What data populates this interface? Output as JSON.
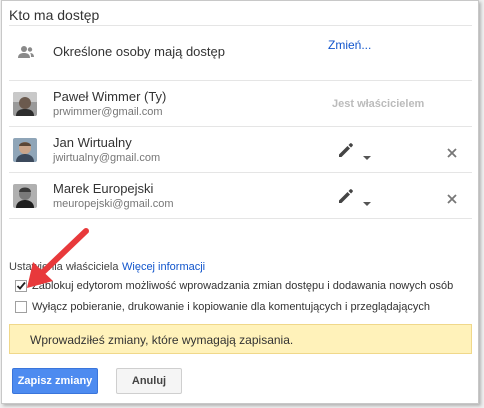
{
  "dialog": {
    "title": "Kto ma dostęp"
  },
  "general_access": {
    "text": "Określone osoby mają dostęp",
    "change_link": "Zmień...",
    "icon": "people-icon"
  },
  "people": [
    {
      "name": "Paweł Wimmer (Ty)",
      "email": "prwimmer@gmail.com",
      "role": "Jest właścicielem"
    },
    {
      "name": "Jan Wirtualny",
      "email": "jwirtualny@gmail.com",
      "role_icon": "pencil-icon"
    },
    {
      "name": "Marek Europejski",
      "email": "meuropejski@gmail.com",
      "role_icon": "pencil-icon"
    }
  ],
  "owner_settings": {
    "label": "Ustawienia właściciela",
    "more_info_link": "Więcej informacji",
    "options": [
      {
        "label": "Zablokuj edytorom możliwość wprowadzania zmian dostępu i dodawania nowych osób",
        "checked": true
      },
      {
        "label": "Wyłącz pobieranie, drukowanie i kopiowanie dla komentujących i przeglądających",
        "checked": false
      }
    ]
  },
  "notice": {
    "text": "Wprowadziłeś zmiany, które wymagają zapisania."
  },
  "buttons": {
    "save": "Zapisz zmiany",
    "cancel": "Anuluj"
  },
  "colors": {
    "accent": "#4d8bf0",
    "link": "#1155cc",
    "notice_bg": "#fff2ba",
    "arrow": "#e8393b"
  }
}
